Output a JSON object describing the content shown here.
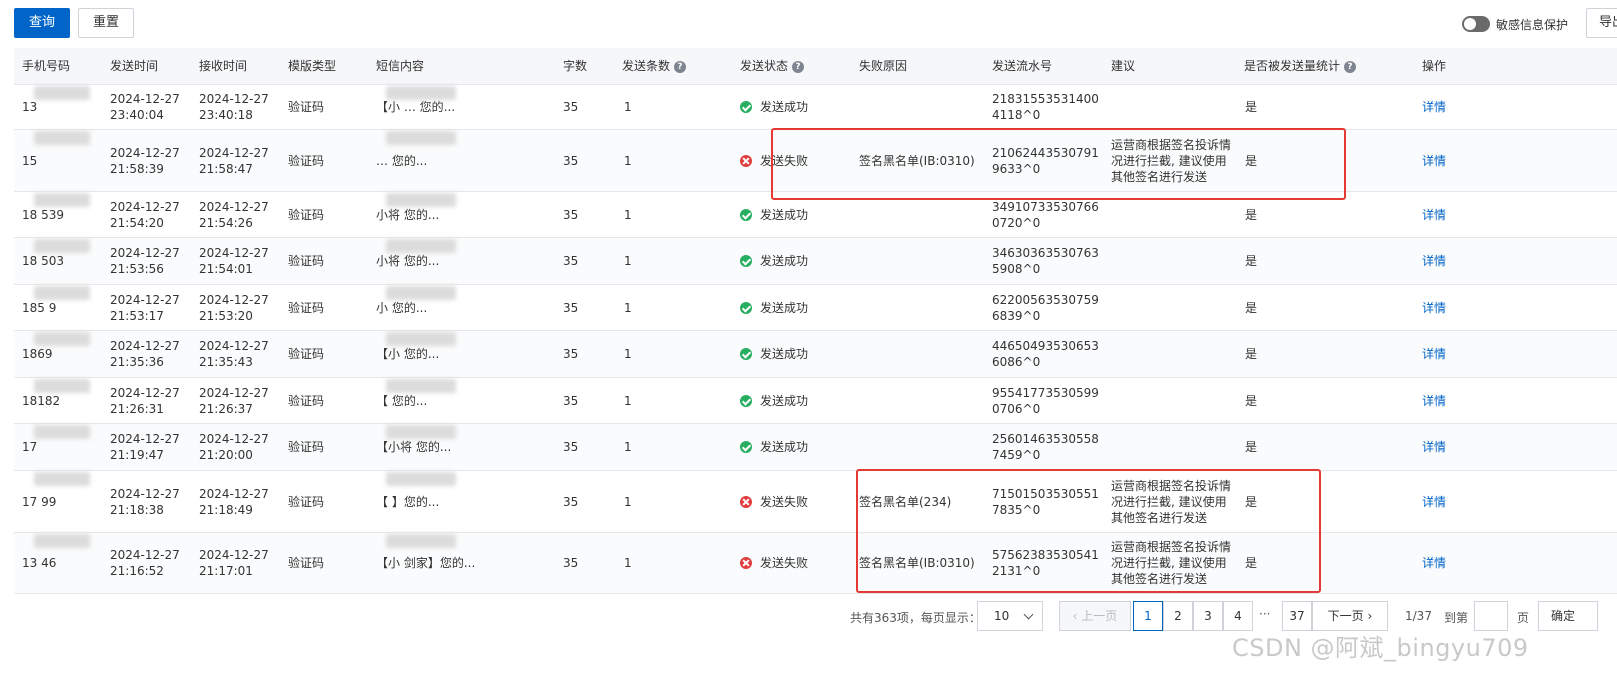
{
  "toolbar": {
    "query_label": "查询",
    "reset_label": "重置",
    "export_label": "导出",
    "sensitive_toggle_label": "敏感信息保护",
    "sensitive_toggle_on": false
  },
  "table": {
    "columns": [
      "手机号码",
      "发送时间",
      "接收时间",
      "模版类型",
      "短信内容",
      "字数",
      "发送条数",
      "发送状态",
      "失败原因",
      "发送流水号",
      "建议",
      "是否被发送量统计",
      "操作"
    ],
    "rows": [
      {
        "phone": "13",
        "send_time": "2024-12-27 23:40:04",
        "recv_time": "2024-12-27 23:40:18",
        "type": "验证码",
        "content": "【小 … 您的...",
        "words": "35",
        "count": "1",
        "status": "发送成功",
        "ok": true,
        "reason": "",
        "serial": "218315535314004118^0",
        "advice": "",
        "counted": "是",
        "action": "详情"
      },
      {
        "phone": "15",
        "send_time": "2024-12-27 21:58:39",
        "recv_time": "2024-12-27 21:58:47",
        "type": "验证码",
        "content": "… 您的...",
        "words": "35",
        "count": "1",
        "status": "发送失败",
        "ok": false,
        "reason": "签名黑名单(IB:0310)",
        "serial": "210624435307919633^0",
        "advice": "运营商根据签名投诉情况进行拦截, 建议使用其他签名进行发送",
        "counted": "是",
        "action": "详情"
      },
      {
        "phone": "18 539",
        "send_time": "2024-12-27 21:54:20",
        "recv_time": "2024-12-27 21:54:26",
        "type": "验证码",
        "content": "小将 您的...",
        "words": "35",
        "count": "1",
        "status": "发送成功",
        "ok": true,
        "reason": "",
        "serial": "349107335307660720^0",
        "advice": "",
        "counted": "是",
        "action": "详情"
      },
      {
        "phone": "18 503",
        "send_time": "2024-12-27 21:53:56",
        "recv_time": "2024-12-27 21:54:01",
        "type": "验证码",
        "content": "小将 您的...",
        "words": "35",
        "count": "1",
        "status": "发送成功",
        "ok": true,
        "reason": "",
        "serial": "346303635307635908^0",
        "advice": "",
        "counted": "是",
        "action": "详情"
      },
      {
        "phone": "185 9",
        "send_time": "2024-12-27 21:53:17",
        "recv_time": "2024-12-27 21:53:20",
        "type": "验证码",
        "content": "小 您的...",
        "words": "35",
        "count": "1",
        "status": "发送成功",
        "ok": true,
        "reason": "",
        "serial": "622005635307596839^0",
        "advice": "",
        "counted": "是",
        "action": "详情"
      },
      {
        "phone": "1869",
        "send_time": "2024-12-27 21:35:36",
        "recv_time": "2024-12-27 21:35:43",
        "type": "验证码",
        "content": "【小 您的...",
        "words": "35",
        "count": "1",
        "status": "发送成功",
        "ok": true,
        "reason": "",
        "serial": "446504935306536086^0",
        "advice": "",
        "counted": "是",
        "action": "详情"
      },
      {
        "phone": "18182",
        "send_time": "2024-12-27 21:26:31",
        "recv_time": "2024-12-27 21:26:37",
        "type": "验证码",
        "content": "【 您的...",
        "words": "35",
        "count": "1",
        "status": "发送成功",
        "ok": true,
        "reason": "",
        "serial": "955417735305990706^0",
        "advice": "",
        "counted": "是",
        "action": "详情"
      },
      {
        "phone": "17",
        "send_time": "2024-12-27 21:19:47",
        "recv_time": "2024-12-27 21:20:00",
        "type": "验证码",
        "content": "【小将 您的...",
        "words": "35",
        "count": "1",
        "status": "发送成功",
        "ok": true,
        "reason": "",
        "serial": "256014635305587459^0",
        "advice": "",
        "counted": "是",
        "action": "详情"
      },
      {
        "phone": "17 99",
        "send_time": "2024-12-27 21:18:38",
        "recv_time": "2024-12-27 21:18:49",
        "type": "验证码",
        "content": "【 】您的...",
        "words": "35",
        "count": "1",
        "status": "发送失败",
        "ok": false,
        "reason": "签名黑名单(234)",
        "serial": "715015035305517835^0",
        "advice": "运营商根据签名投诉情况进行拦截, 建议使用其他签名进行发送",
        "counted": "是",
        "action": "详情"
      },
      {
        "phone": "13 46",
        "send_time": "2024-12-27 21:16:52",
        "recv_time": "2024-12-27 21:17:01",
        "type": "验证码",
        "content": "【小 剑家】您的...",
        "words": "35",
        "count": "1",
        "status": "发送失败",
        "ok": false,
        "reason": "签名黑名单(IB:0310)",
        "serial": "575623835305412131^0",
        "advice": "运营商根据签名投诉情况进行拦截, 建议使用其他签名进行发送",
        "counted": "是",
        "action": "详情"
      }
    ]
  },
  "pagination": {
    "total_label": "共有363项，每页显示：",
    "page_size": "10",
    "prev_label": "上一页",
    "pages": [
      "1",
      "2",
      "3",
      "4"
    ],
    "ellipsis": "···",
    "last_page": "37",
    "next_label": "下一页",
    "current_of_total": "1/37",
    "goto_label": "到第",
    "page_unit": "页",
    "confirm_label": "确定"
  },
  "watermark": "CSDN @阿斌_bingyu709",
  "colors": {
    "primary": "#0064c8",
    "success": "#27ae60",
    "fail": "#e03e3e",
    "highlight": "#e53935"
  }
}
